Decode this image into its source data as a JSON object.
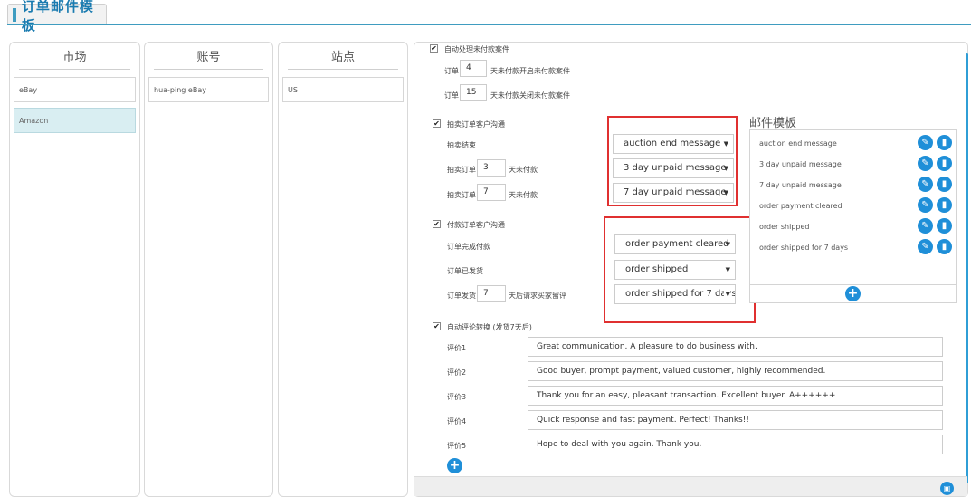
{
  "page_title": "订单邮件模板",
  "columns": {
    "market": {
      "header": "市场",
      "items": [
        "eBay",
        "Amazon"
      ]
    },
    "account": {
      "header": "账号",
      "items": [
        "hua-ping eBay"
      ]
    },
    "site": {
      "header": "站点",
      "items": [
        "US"
      ]
    }
  },
  "unpaid": {
    "label": "自动处理未付款案件",
    "checked": "✔",
    "open_prefix": "订单",
    "open_days": "4",
    "open_suffix": "天未付款开启未付款案件",
    "close_prefix": "订单",
    "close_days": "15",
    "close_suffix": "天未付款关闭未付款案件"
  },
  "auction": {
    "label": "拍卖订单客户沟通",
    "checked": "✔",
    "end_label": "拍卖结束",
    "order1_prefix": "拍卖订单",
    "order1_days": "3",
    "order1_suffix": "天未付款",
    "order2_prefix": "拍卖订单",
    "order2_days": "7",
    "order2_suffix": "天未付款",
    "selects": [
      "auction end message",
      "3 day unpaid message",
      "7 day unpaid message"
    ]
  },
  "paid": {
    "label": "付款订单客户沟通",
    "checked": "✔",
    "completed_label": "订单完成付款",
    "shipped_label": "订单已发货",
    "ship_prefix": "订单发货",
    "ship_days": "7",
    "ship_suffix": "天后请求买家留评",
    "selects": [
      "order payment cleared",
      "order shipped",
      "order shipped for 7 days"
    ]
  },
  "templates": {
    "title": "邮件模板",
    "items": [
      "auction end message",
      "3 day unpaid message",
      "7 day unpaid message",
      "order payment cleared",
      "order shipped",
      "order shipped for 7 days"
    ]
  },
  "review": {
    "label": "自动评论转换 (发货7天后)",
    "checked": "✔",
    "items": [
      {
        "label": "评价1",
        "value": "Great communication. A pleasure to do business with."
      },
      {
        "label": "评价2",
        "value": "Good buyer, prompt payment, valued customer, highly recommended."
      },
      {
        "label": "评价3",
        "value": "Thank you for an easy, pleasant transaction. Excellent buyer. A++++++"
      },
      {
        "label": "评价4",
        "value": "Quick response and fast payment. Perfect! Thanks!!"
      },
      {
        "label": "评价5",
        "value": "Hope to deal with you again. Thank you."
      }
    ]
  },
  "icons": {
    "edit": "edit-icon",
    "delete": "trash-icon",
    "add": "plus-icon",
    "save": "save-icon",
    "select_arrow": "▼"
  },
  "colors": {
    "accent": "#1f8fd8",
    "highlight": "#e03030",
    "active_row": "#d9eef2"
  }
}
